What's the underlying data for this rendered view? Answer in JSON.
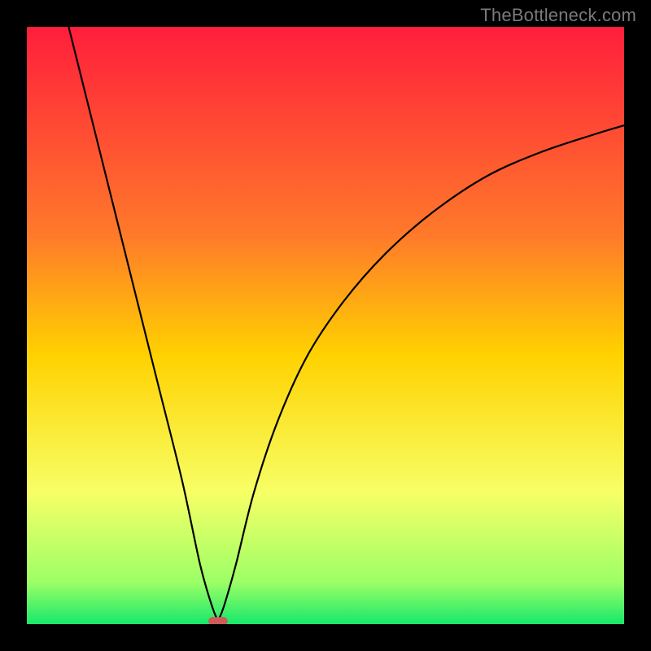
{
  "watermark": "TheBottleneck.com",
  "chart_data": {
    "type": "line",
    "title": "",
    "xlabel": "",
    "ylabel": "",
    "xlim": [
      0,
      100
    ],
    "ylim": [
      0,
      100
    ],
    "gradient_stops": [
      {
        "offset": 0,
        "color": "#ff1e3c"
      },
      {
        "offset": 0.35,
        "color": "#ff7a2a"
      },
      {
        "offset": 0.55,
        "color": "#ffd200"
      },
      {
        "offset": 0.78,
        "color": "#f7ff66"
      },
      {
        "offset": 0.93,
        "color": "#9cff66"
      },
      {
        "offset": 1,
        "color": "#17e86b"
      }
    ],
    "curve": {
      "minimum_x": 32,
      "left_branch": [
        {
          "x": 7,
          "y": 100
        },
        {
          "x": 10,
          "y": 88
        },
        {
          "x": 14,
          "y": 72
        },
        {
          "x": 18,
          "y": 56
        },
        {
          "x": 22,
          "y": 40
        },
        {
          "x": 26,
          "y": 24
        },
        {
          "x": 29,
          "y": 10
        },
        {
          "x": 31,
          "y": 3
        },
        {
          "x": 32,
          "y": 0.5
        }
      ],
      "right_branch": [
        {
          "x": 32,
          "y": 0.5
        },
        {
          "x": 33,
          "y": 3
        },
        {
          "x": 35,
          "y": 10
        },
        {
          "x": 38,
          "y": 22
        },
        {
          "x": 42,
          "y": 34
        },
        {
          "x": 47,
          "y": 45
        },
        {
          "x": 53,
          "y": 54
        },
        {
          "x": 60,
          "y": 62
        },
        {
          "x": 68,
          "y": 69
        },
        {
          "x": 77,
          "y": 75
        },
        {
          "x": 86,
          "y": 79
        },
        {
          "x": 95,
          "y": 82
        },
        {
          "x": 100,
          "y": 83.5
        }
      ]
    },
    "marker": {
      "x": 32,
      "y": 0.5,
      "w": 3.2,
      "h": 1.4,
      "color": "#cf5a5a"
    }
  }
}
